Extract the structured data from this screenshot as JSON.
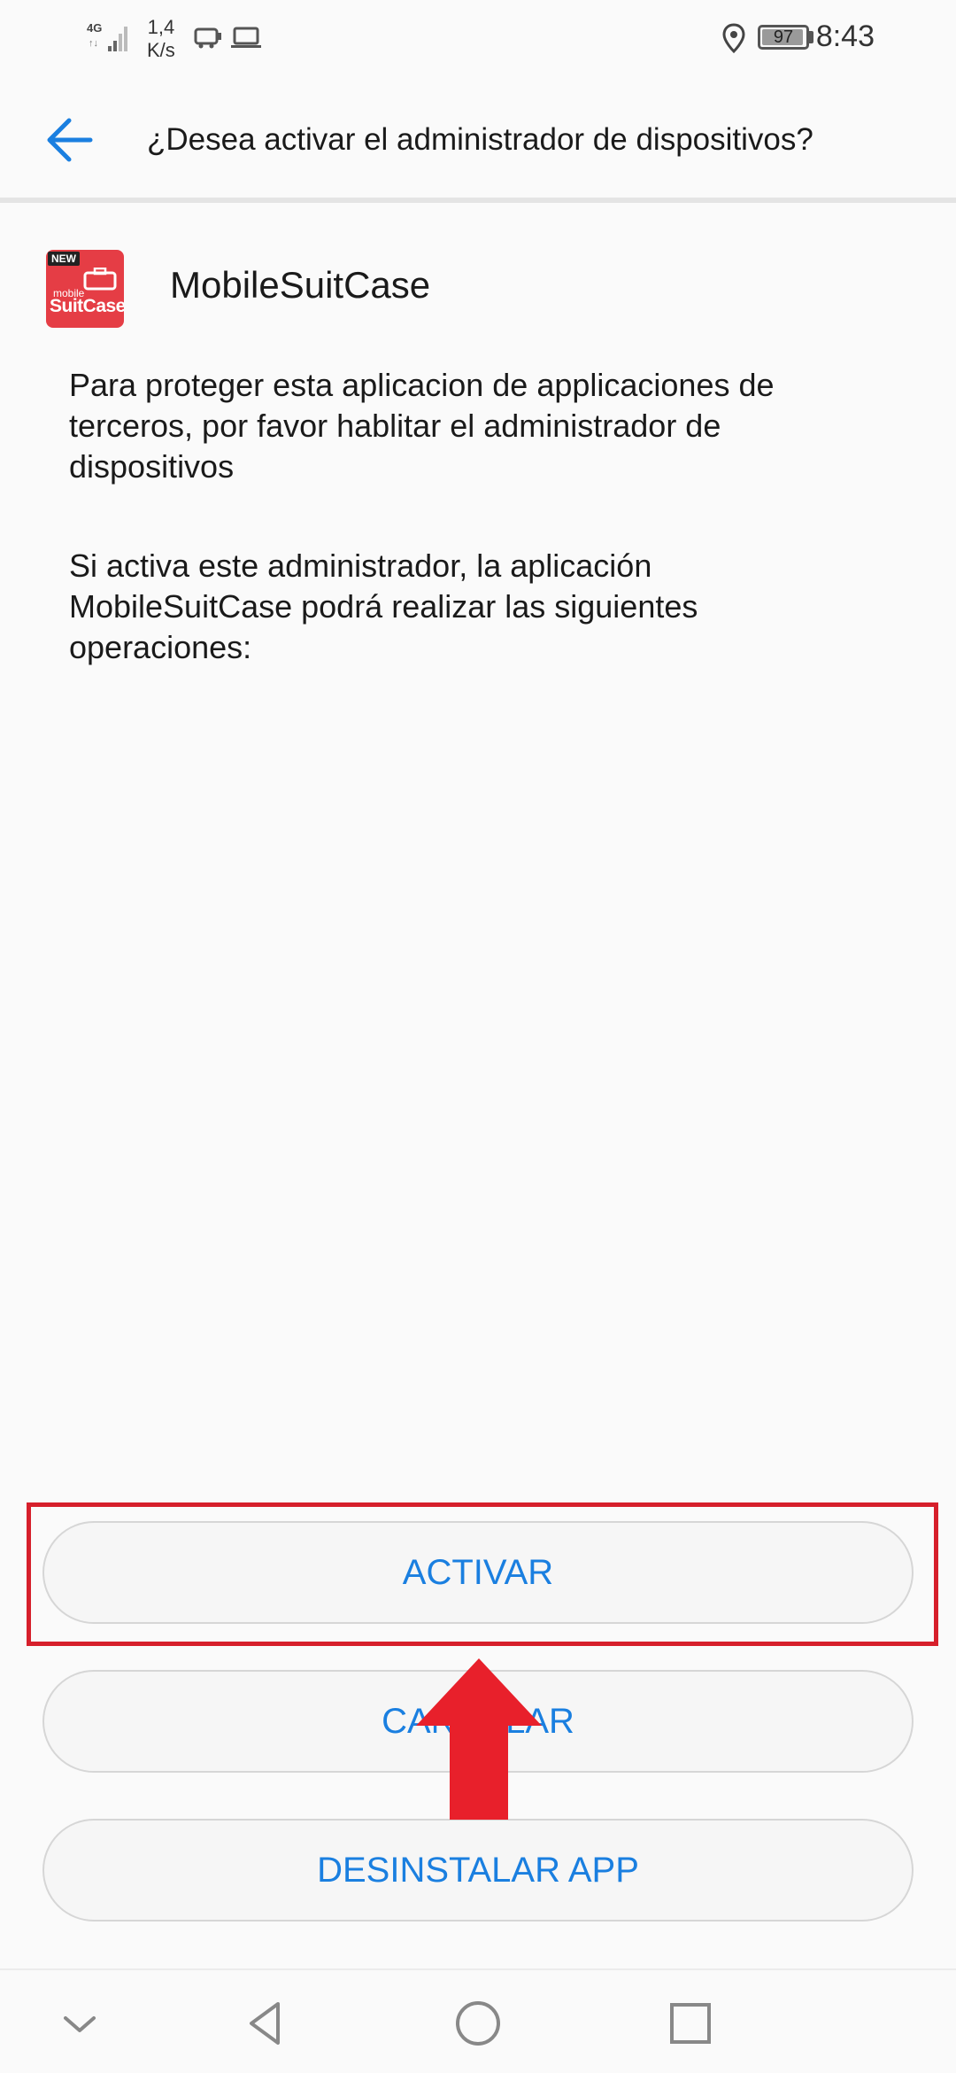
{
  "status_bar": {
    "network_type": "4G",
    "speed_value": "1,4",
    "speed_unit": "K/s",
    "battery": "97",
    "time": "8:43"
  },
  "header": {
    "title": "¿Desea activar el administrador de dispositivos?"
  },
  "app": {
    "name": "MobileSuitCase",
    "icon_badge": "NEW",
    "icon_brand_small": "mobile",
    "icon_brand": "SuitCase"
  },
  "content": {
    "paragraph_1": "Para proteger esta aplicacion de applicaciones de terceros, por favor hablitar el administrador de dispositivos",
    "paragraph_2": "Si activa este administrador, la aplicación MobileSuitCase podrá realizar las siguientes operaciones:"
  },
  "buttons": {
    "activate": "ACTIVAR",
    "cancel": "CANCELAR",
    "uninstall": "DESINSTALAR APP"
  },
  "colors": {
    "accent": "#1a7fe0",
    "highlight": "#d61f2b",
    "arrow": "#e8202b",
    "app_icon": "#e53d45"
  },
  "icons": {
    "back": "arrow-left-icon",
    "location": "location-pin-icon",
    "nav_collapse": "chevron-down-icon",
    "nav_back": "triangle-back-icon",
    "nav_home": "circle-home-icon",
    "nav_recents": "square-recents-icon"
  }
}
